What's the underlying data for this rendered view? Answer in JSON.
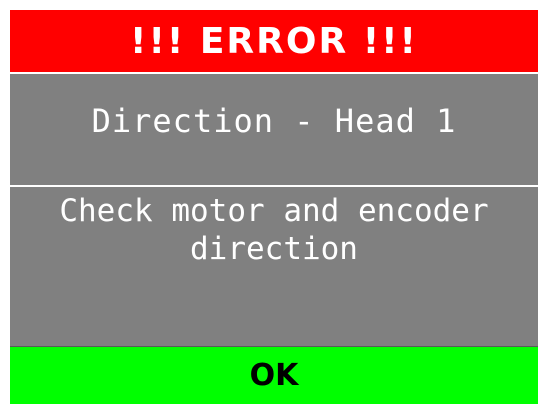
{
  "dialog": {
    "header": "!!! ERROR !!!",
    "title": "Direction - Head 1",
    "message": "Check motor and encoder direction",
    "ok_label": "OK"
  },
  "colors": {
    "header_bg": "#ff0000",
    "body_bg": "#808080",
    "ok_bg": "#00ff00",
    "text_light": "#ffffff",
    "text_dark": "#000000"
  }
}
